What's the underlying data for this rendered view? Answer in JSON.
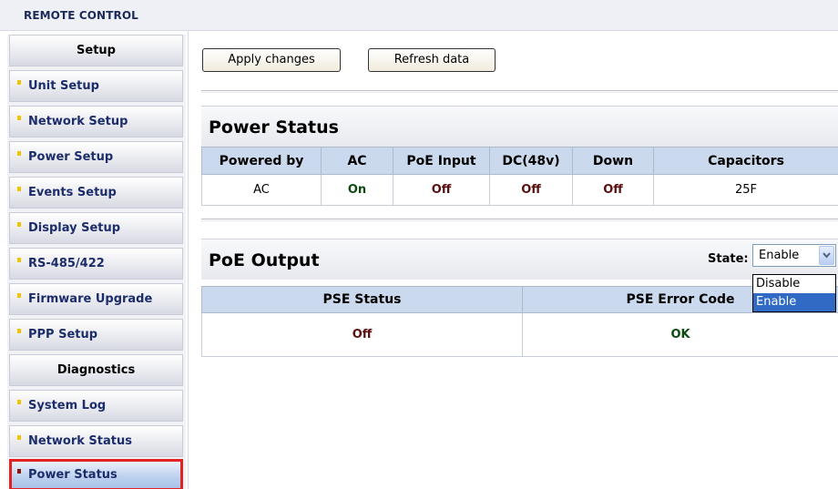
{
  "header": {
    "title": "REMOTE CONTROL"
  },
  "sidebar": {
    "items": [
      {
        "label": "Setup",
        "type": "heading"
      },
      {
        "label": "Unit Setup",
        "type": "link"
      },
      {
        "label": "Network Setup",
        "type": "link"
      },
      {
        "label": "Power Setup",
        "type": "link"
      },
      {
        "label": "Events Setup",
        "type": "link"
      },
      {
        "label": "Display Setup",
        "type": "link"
      },
      {
        "label": "RS-485/422",
        "type": "link"
      },
      {
        "label": "Firmware Upgrade",
        "type": "link"
      },
      {
        "label": "PPP Setup",
        "type": "link"
      },
      {
        "label": "Diagnostics",
        "type": "heading"
      },
      {
        "label": "System Log",
        "type": "link"
      },
      {
        "label": "Network Status",
        "type": "link"
      },
      {
        "label": "Power Status",
        "type": "link",
        "active": true
      }
    ]
  },
  "toolbar": {
    "apply_label": "Apply changes",
    "refresh_label": "Refresh data"
  },
  "power_status": {
    "title": "Power Status",
    "columns": [
      "Powered by",
      "AC",
      "PoE Input",
      "DC(48v)",
      "Down",
      "Capacitors"
    ],
    "values": [
      "AC",
      "On",
      "Off",
      "Off",
      "Off",
      "25F"
    ]
  },
  "poe_output": {
    "title": "PoE Output",
    "state_label": "State:",
    "state_value": "Enable",
    "state_options": [
      "Disable",
      "Enable"
    ],
    "columns": [
      "PSE Status",
      "PSE Error Code"
    ],
    "values": [
      "Off",
      "OK"
    ]
  },
  "colors": {
    "active_highlight": "#e22222",
    "bullet": "#f2c400",
    "table_header": "#cbd9ee",
    "selected_option": "#316ac5"
  }
}
